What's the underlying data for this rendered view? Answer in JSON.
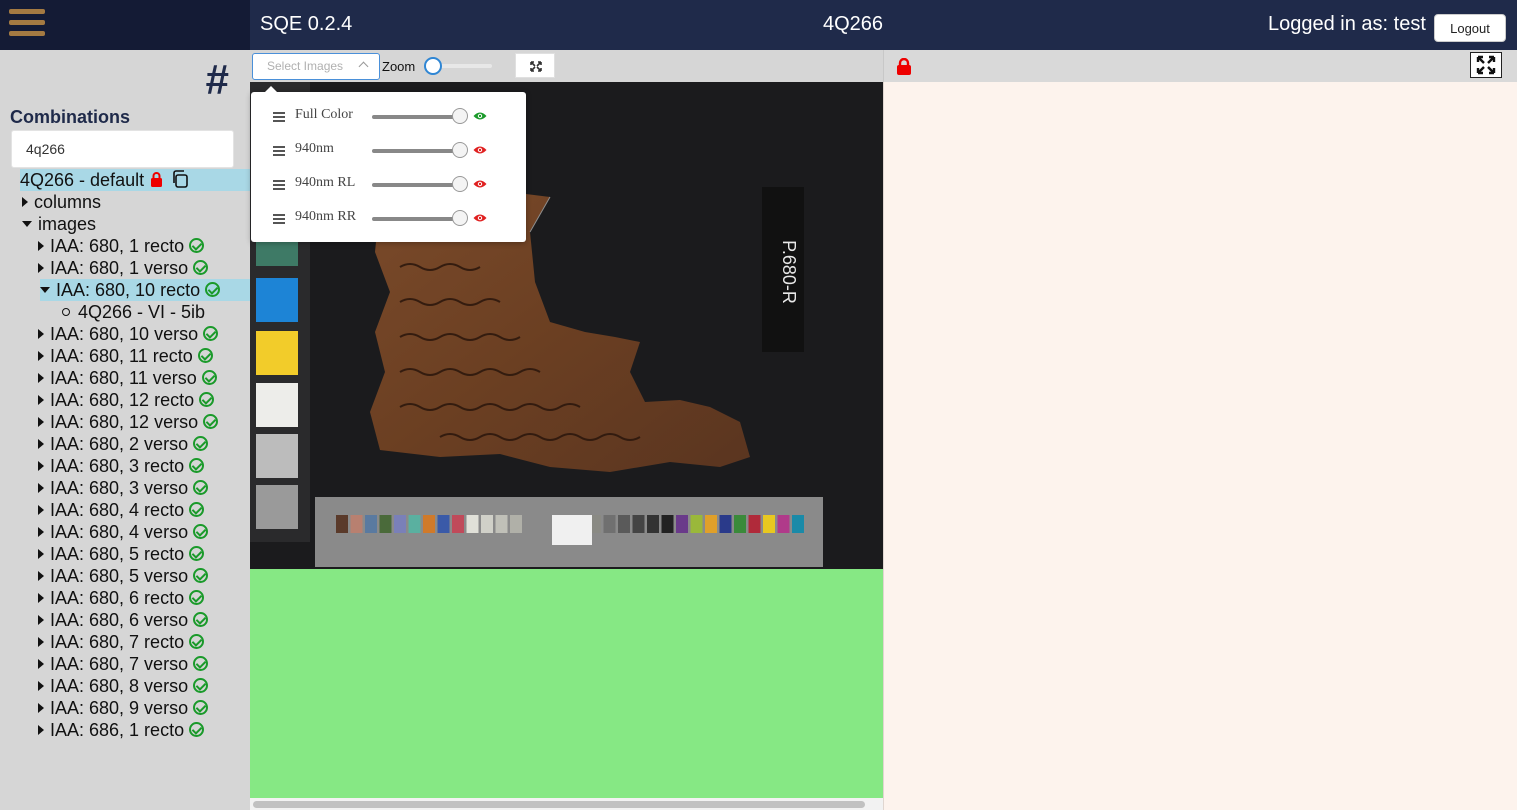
{
  "header": {
    "app_title": "SQE 0.2.4",
    "scroll_title": "4Q266",
    "logged_in_text": "Logged in as: test",
    "logout_label": "Logout",
    "menu_icon": "hamburger-icon"
  },
  "sidebar": {
    "hash_symbol": "#",
    "combinations_title": "Combinations",
    "search_value": "4q266",
    "combination": {
      "label": "4Q266 - default",
      "lock_icon": "lock-icon",
      "copy_icon": "copy-icon"
    },
    "folders": [
      {
        "label": "columns",
        "expanded": false
      },
      {
        "label": "images",
        "expanded": true
      }
    ],
    "images": [
      "IAA: 680, 1 recto",
      "IAA: 680, 1 verso",
      "IAA: 680, 10 recto",
      "IAA: 680, 10 verso",
      "IAA: 680, 11 recto",
      "IAA: 680, 11 verso",
      "IAA: 680, 12 recto",
      "IAA: 680, 12 verso",
      "IAA: 680, 2 verso",
      "IAA: 680, 3 recto",
      "IAA: 680, 3 verso",
      "IAA: 680, 4 recto",
      "IAA: 680, 4 verso",
      "IAA: 680, 5 recto",
      "IAA: 680, 5 verso",
      "IAA: 680, 6 recto",
      "IAA: 680, 6 verso",
      "IAA: 680, 7 recto",
      "IAA: 680, 7 verso",
      "IAA: 680, 8 verso",
      "IAA: 680, 9 verso",
      "IAA: 686, 1 recto"
    ],
    "selected_image": "IAA: 680, 10 recto",
    "sub_item": "4Q266 - VI - 5ib"
  },
  "toolbar": {
    "select_placeholder": "Select Images",
    "zoom_label": "Zoom",
    "zoom_value": 0,
    "fit_icon": "fit-screen-icon"
  },
  "image_layers": [
    {
      "label": "Full Color",
      "opacity": 1.0,
      "visible": true,
      "eye_color": "#1a9a2a"
    },
    {
      "label": "940nm",
      "opacity": 1.0,
      "visible": false,
      "eye_color": "#e02020"
    },
    {
      "label": "940nm RL",
      "opacity": 1.0,
      "visible": false,
      "eye_color": "#e02020"
    },
    {
      "label": "940nm RR",
      "opacity": 1.0,
      "visible": false,
      "eye_color": "#e02020"
    }
  ],
  "image_pane": {
    "plate_label": "P.680-R"
  },
  "right_pane": {
    "lock_icon": "lock-icon",
    "expand_icon": "expand-icon"
  },
  "colors": {
    "header_bg": "#1f2a4a",
    "sidebar_bg": "#d6d6d6",
    "selected_bg": "#a9d8e6",
    "green_area": "#86e884",
    "right_pane_bg": "#fdf3ed",
    "hamburger": "#a47a42"
  }
}
